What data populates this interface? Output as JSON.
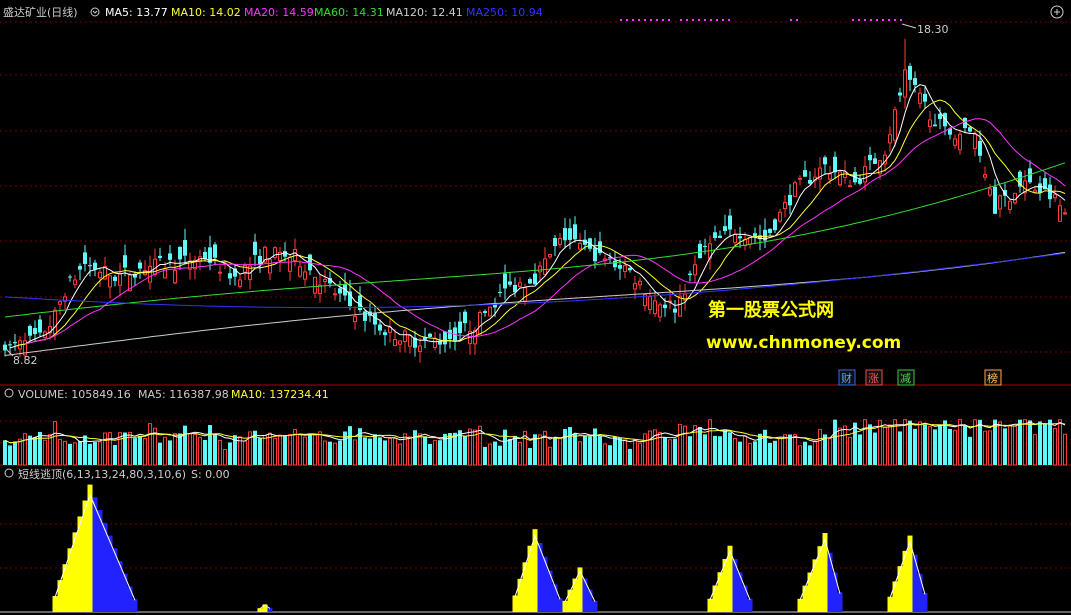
{
  "colors": {
    "background": "#000000",
    "grid": "#7a0000",
    "separator": "#b00000",
    "up": "#ff3b3b",
    "down": "#5ff8f8",
    "ma5": "#ffffff",
    "ma10": "#ffff33",
    "ma20": "#ff33ff",
    "ma60": "#33dd33",
    "ma120": "#cccccc",
    "ma250": "#3333ff",
    "brand": "#ffff00",
    "label": "#cccccc",
    "ind_up": "#ffff00",
    "ind_down": "#2222ff"
  },
  "header": {
    "stock_name": "盛达矿业(日线)",
    "ma5_label": "MA5: 13.77",
    "ma10_label": "MA10: 14.02",
    "ma20_label": "MA20: 14.59",
    "ma60_label": "MA60: 14.31",
    "ma120_label": "MA120: 12.41",
    "ma250_label": "MA250: 10.94"
  },
  "price_annotations": {
    "high": "18.30",
    "low": "8.82"
  },
  "watermark": {
    "line1": "第一股票公式网",
    "line2": "www.chnmoney.com"
  },
  "event_markers": [
    "财",
    "涨",
    "减",
    "榜"
  ],
  "volume_header": {
    "volume_label": "VOLUME: 105849.16",
    "ma5_label": "MA5: 116387.98",
    "ma10_label": "MA10: 137234.41"
  },
  "indicator_header": {
    "name": "短线逃顶(6,13,13,24,80,3,10,6)",
    "value": "S: 0.00"
  },
  "chart_data": [
    {
      "type": "candlestick",
      "title": "盛达矿业(日线)",
      "y_range": [
        8.0,
        18.8
      ],
      "highest_price": 18.3,
      "lowest_price": 8.82,
      "series": [
        {
          "name": "MA5",
          "last_value": 13.77
        },
        {
          "name": "MA10",
          "last_value": 14.02
        },
        {
          "name": "MA20",
          "last_value": 14.59
        },
        {
          "name": "MA60",
          "last_value": 14.31
        },
        {
          "name": "MA120",
          "last_value": 12.41
        },
        {
          "name": "MA250",
          "last_value": 10.94
        }
      ],
      "approx_close_path": [
        [
          0,
          9.0
        ],
        [
          8,
          9.4
        ],
        [
          12,
          10.8
        ],
        [
          16,
          11.6
        ],
        [
          22,
          11.2
        ],
        [
          28,
          11.5
        ],
        [
          34,
          11.6
        ],
        [
          40,
          11.8
        ],
        [
          46,
          11.2
        ],
        [
          52,
          11.9
        ],
        [
          58,
          11.8
        ],
        [
          64,
          11.0
        ],
        [
          70,
          10.2
        ],
        [
          76,
          9.6
        ],
        [
          82,
          9.3
        ],
        [
          88,
          9.3
        ],
        [
          94,
          9.8
        ],
        [
          100,
          10.8
        ],
        [
          106,
          11.2
        ],
        [
          112,
          12.4
        ],
        [
          118,
          11.8
        ],
        [
          124,
          11.5
        ],
        [
          130,
          10.5
        ],
        [
          134,
          10.3
        ],
        [
          140,
          12.0
        ],
        [
          146,
          12.6
        ],
        [
          152,
          12.3
        ],
        [
          158,
          13.8
        ],
        [
          164,
          14.5
        ],
        [
          170,
          14.0
        ],
        [
          176,
          15.0
        ],
        [
          180,
          17.2
        ],
        [
          183,
          16.5
        ],
        [
          188,
          15.5
        ],
        [
          194,
          15.5
        ],
        [
          198,
          13.3
        ],
        [
          204,
          14.0
        ],
        [
          210,
          13.5
        ],
        [
          212,
          13.1
        ]
      ]
    },
    {
      "type": "bar",
      "title": "VOLUME",
      "current_volume": 105849.16,
      "ma5": 116387.98,
      "ma10": 137234.41
    },
    {
      "type": "bar",
      "title": "短线逃顶(6,13,13,24,80,3,10,6)",
      "current_value": 0,
      "y_range": [
        0,
        100
      ],
      "waves": [
        {
          "start": 10,
          "peak": 17,
          "end": 26,
          "peak_value": 100
        },
        {
          "start": 51,
          "peak": 52,
          "end": 53,
          "peak_value": 6
        },
        {
          "start": 102,
          "peak": 106,
          "end": 111,
          "peak_value": 65
        },
        {
          "start": 112,
          "peak": 115,
          "end": 118,
          "peak_value": 35
        },
        {
          "start": 141,
          "peak": 145,
          "end": 149,
          "peak_value": 52
        },
        {
          "start": 159,
          "peak": 164,
          "end": 167,
          "peak_value": 62
        },
        {
          "start": 177,
          "peak": 181,
          "end": 184,
          "peak_value": 60
        }
      ]
    }
  ]
}
